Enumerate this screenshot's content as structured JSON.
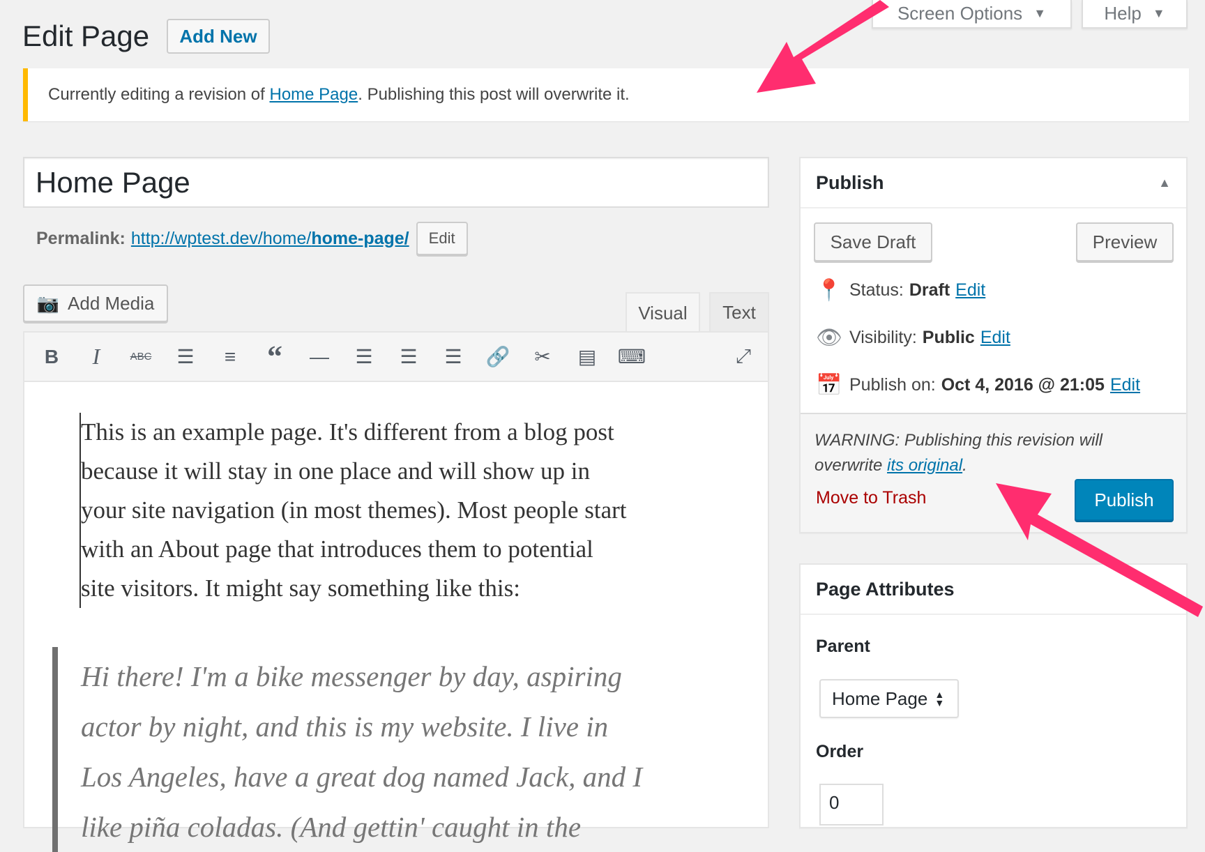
{
  "header": {
    "title": "Edit Page",
    "add_new": "Add New",
    "screen_options": "Screen Options",
    "help": "Help"
  },
  "notice": {
    "prefix": "Currently editing a revision of ",
    "link": "Home Page",
    "suffix": ". Publishing this post will overwrite it.",
    "accent": "#ffb900"
  },
  "editor": {
    "title_value": "Home Page",
    "permalink_label": "Permalink:",
    "permalink_base": "http://wptest.dev/home/",
    "permalink_slug": "home-page/",
    "permalink_edit": "Edit",
    "add_media": "Add Media",
    "tabs": {
      "visual": "Visual",
      "text": "Text"
    },
    "toolbar": [
      "bold",
      "italic",
      "strikethrough",
      "bulleted-list",
      "numbered-list",
      "blockquote",
      "horizontal-line",
      "align-left",
      "align-center",
      "align-right",
      "insert-link",
      "remove-link",
      "read-more",
      "toolbar-toggle",
      "fullscreen"
    ],
    "paragraph_lines": [
      "This is an example page. It's different from a blog post",
      "because it will stay in one place and will show up in",
      "your site navigation (in most themes). Most people start",
      "with an About page that introduces them to potential",
      "site visitors. It might say something like this:"
    ],
    "quote_lines": [
      "Hi there! I'm a bike messenger by day, aspiring",
      "actor by night, and this is my website. I live in",
      "Los Angeles, have a great dog named Jack, and I",
      "like piña coladas. (And gettin' caught in the"
    ]
  },
  "publish": {
    "title": "Publish",
    "save_draft": "Save Draft",
    "preview": "Preview",
    "status_label": "Status:",
    "status_value": "Draft",
    "visibility_label": "Visibility:",
    "visibility_value": "Public",
    "publish_on_label": "Publish on:",
    "publish_on_value": "Oct 4, 2016 @ 21:05",
    "edit": "Edit",
    "warning_prefix": "WARNING: Publishing this revision will overwrite ",
    "warning_link": "its original",
    "warning_suffix": ".",
    "trash": "Move to Trash",
    "publish_button": "Publish",
    "accent": "#0085ba"
  },
  "attributes": {
    "title": "Page Attributes",
    "parent_label": "Parent",
    "parent_value": "Home Page",
    "order_label": "Order",
    "order_value": "0"
  },
  "annotation": {
    "arrow_color": "#ff2d6f"
  }
}
